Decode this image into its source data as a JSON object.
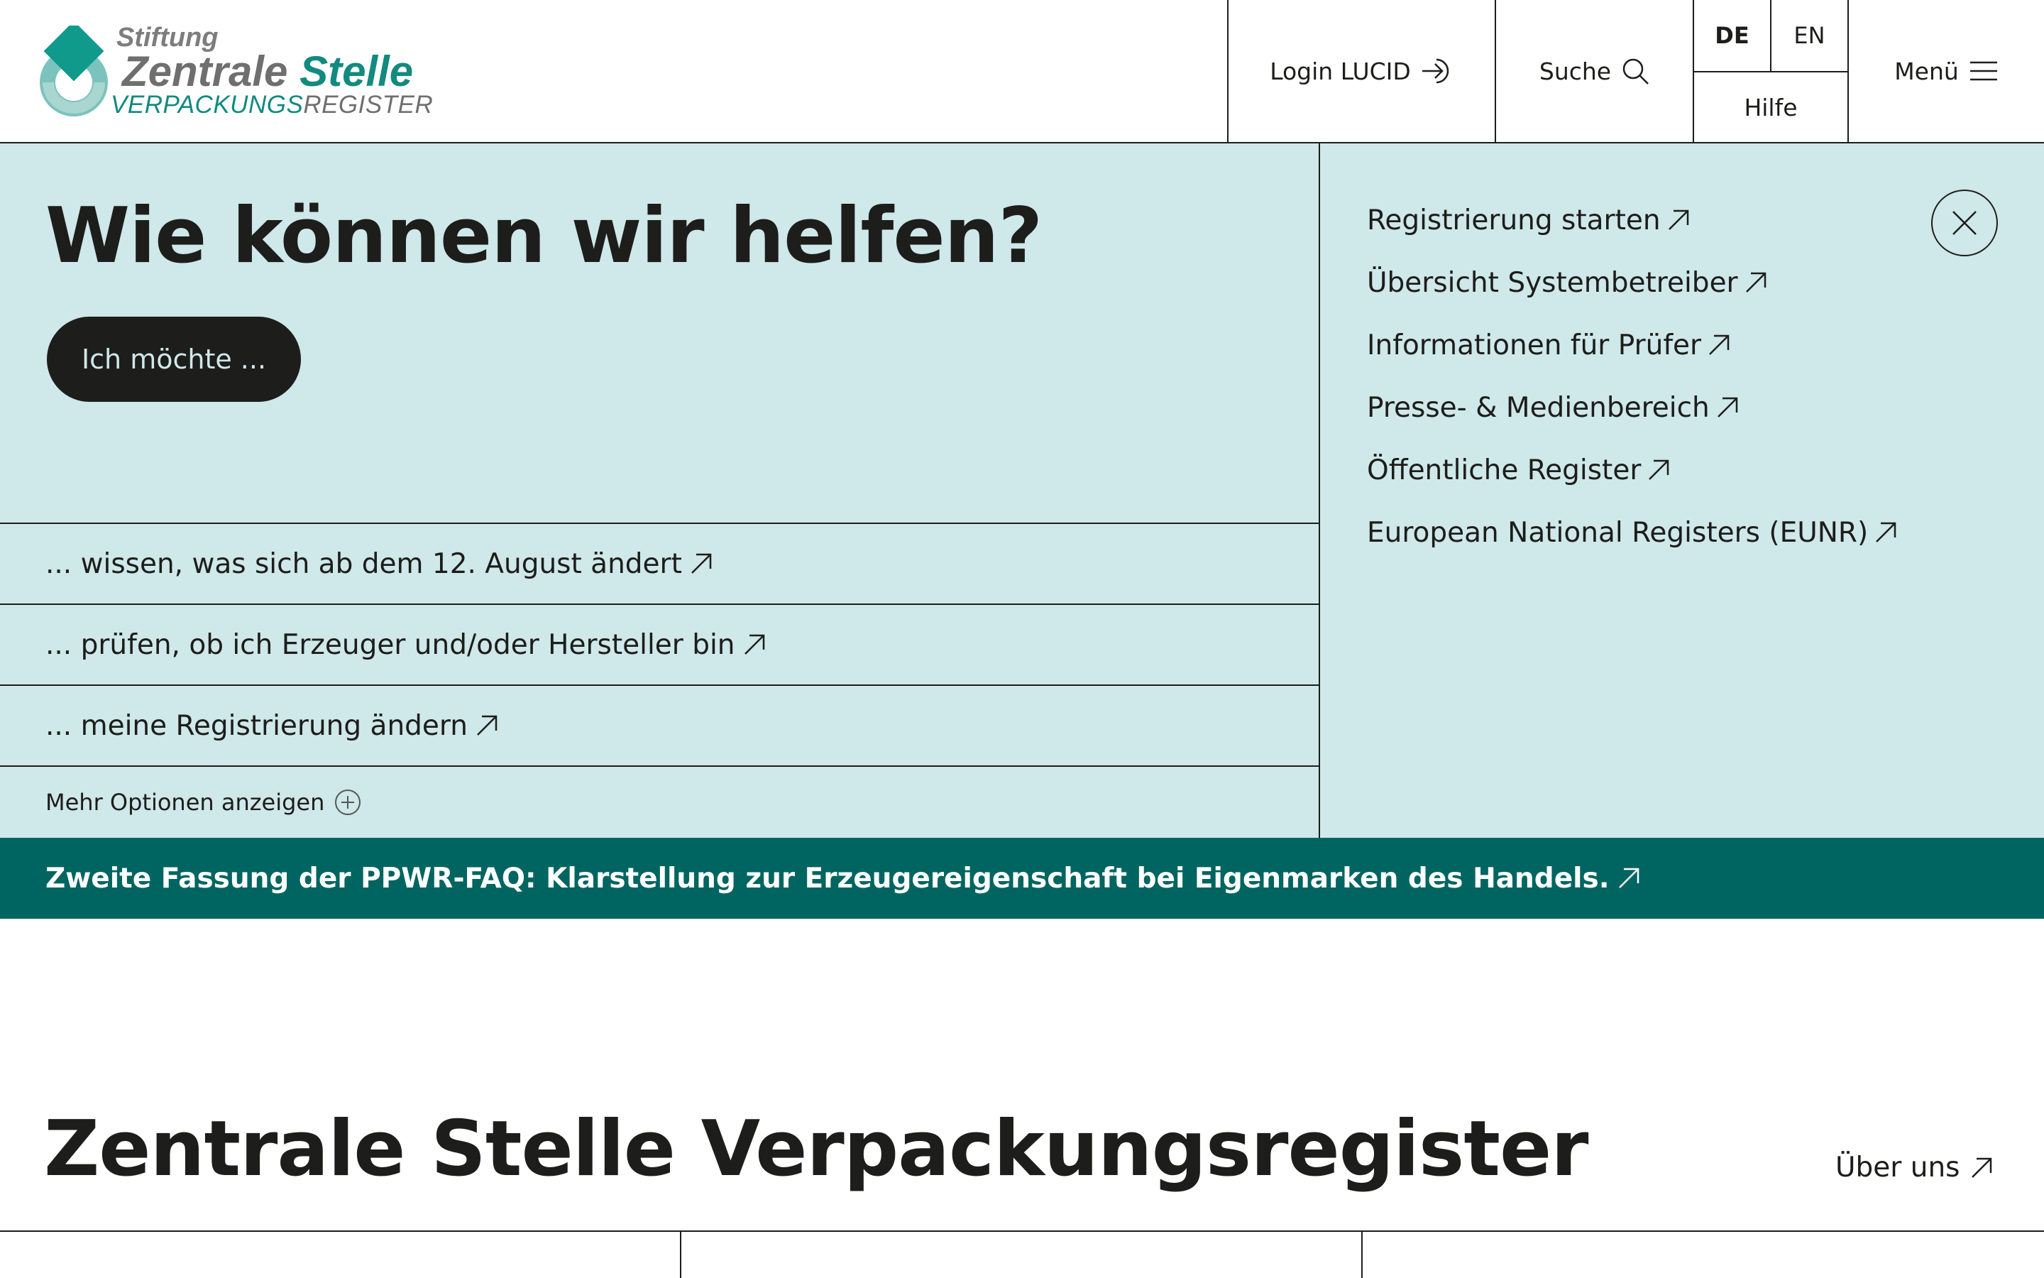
{
  "header": {
    "logo": {
      "stiftung": "Stiftung",
      "name_part1": "Zentrale",
      "name_part2": "Stelle",
      "sub_part1": "VERPACKUNGS",
      "sub_part2": "REGISTER"
    },
    "login_label": "Login LUCID",
    "search_label": "Suche",
    "lang_de": "DE",
    "lang_en": "EN",
    "help_label": "Hilfe",
    "menu_label": "Menü",
    "icons": {
      "login": "login-arrow-icon",
      "search": "search-icon",
      "menu": "hamburger-icon"
    }
  },
  "hero": {
    "title": "Wie können wir helfen?",
    "cta_label": "Ich möchte ...",
    "options": [
      "... wissen, was sich ab dem 12. August ändert",
      "... prüfen, ob ich Erzeuger und/oder Hersteller bin",
      "... meine Registrierung ändern"
    ],
    "more_label": "Mehr Optionen anzeigen",
    "quick_links": [
      "Registrierung starten",
      "Übersicht Systembetreiber",
      "Informationen für Prüfer",
      "Presse- & Medienbereich",
      "Öffentliche Register",
      "European National Registers (EUNR)"
    ],
    "icons": {
      "link": "arrow-up-right-icon",
      "more": "plus-circle-icon",
      "close": "close-icon"
    }
  },
  "banner": {
    "text": "Zweite Fassung der PPWR-FAQ: Klarstellung zur Erzeugereigenschaft bei Eigenmarken des Handels."
  },
  "section": {
    "title": "Zentrale Stelle Verpackungsregister",
    "about_label": "Über uns"
  },
  "colors": {
    "hero_bg": "#cfe8e9",
    "banner_bg": "#006560",
    "brand_teal": "#128a7f",
    "text": "#1d1d1b"
  }
}
